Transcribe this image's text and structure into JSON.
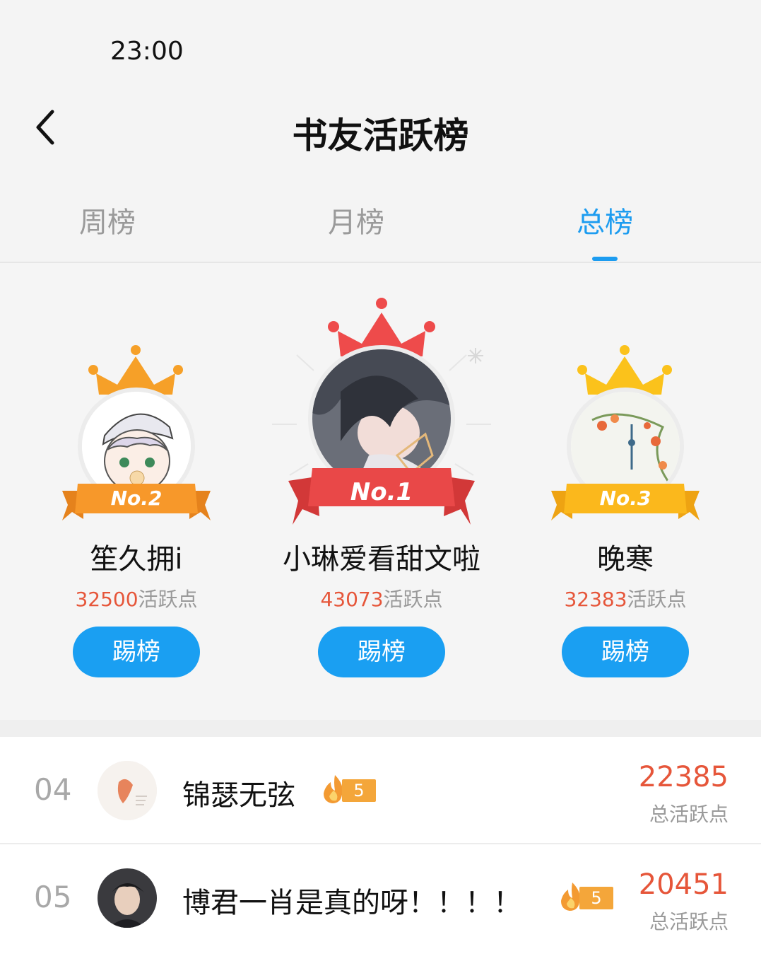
{
  "status_bar": {
    "time": "23:00"
  },
  "nav": {
    "title": "书友活跃榜",
    "back_icon": "chevron-left-icon"
  },
  "tabs": [
    {
      "label": "周榜",
      "active": false
    },
    {
      "label": "月榜",
      "active": false
    },
    {
      "label": "总榜",
      "active": true
    }
  ],
  "accent_color": "#1c9cf0",
  "score_color": "#e6563a",
  "podium": {
    "first": {
      "rank_label": "No.1",
      "name": "小琳爱看甜文啦",
      "points": "43073",
      "points_suffix": "活跃点",
      "button": "踢榜",
      "crown_color": "#ee4b4b",
      "ribbon_color": "#e94848"
    },
    "second": {
      "rank_label": "No.2",
      "name": "笙久拥i",
      "points": "32500",
      "points_suffix": "活跃点",
      "button": "踢榜",
      "crown_color": "#f6a028",
      "ribbon_color": "#f7982a"
    },
    "third": {
      "rank_label": "No.3",
      "name": "晚寒",
      "points": "32383",
      "points_suffix": "活跃点",
      "button": "踢榜",
      "crown_color": "#fbc21b",
      "ribbon_color": "#fbb81c"
    }
  },
  "list": [
    {
      "rank": "04",
      "name": "锦瑟无弦",
      "level": "5",
      "score": "22385",
      "score_label": "总活跃点"
    },
    {
      "rank": "05",
      "name": "博君一肖是真的呀！！！！",
      "level": "5",
      "score": "20451",
      "score_label": "总活跃点"
    }
  ]
}
